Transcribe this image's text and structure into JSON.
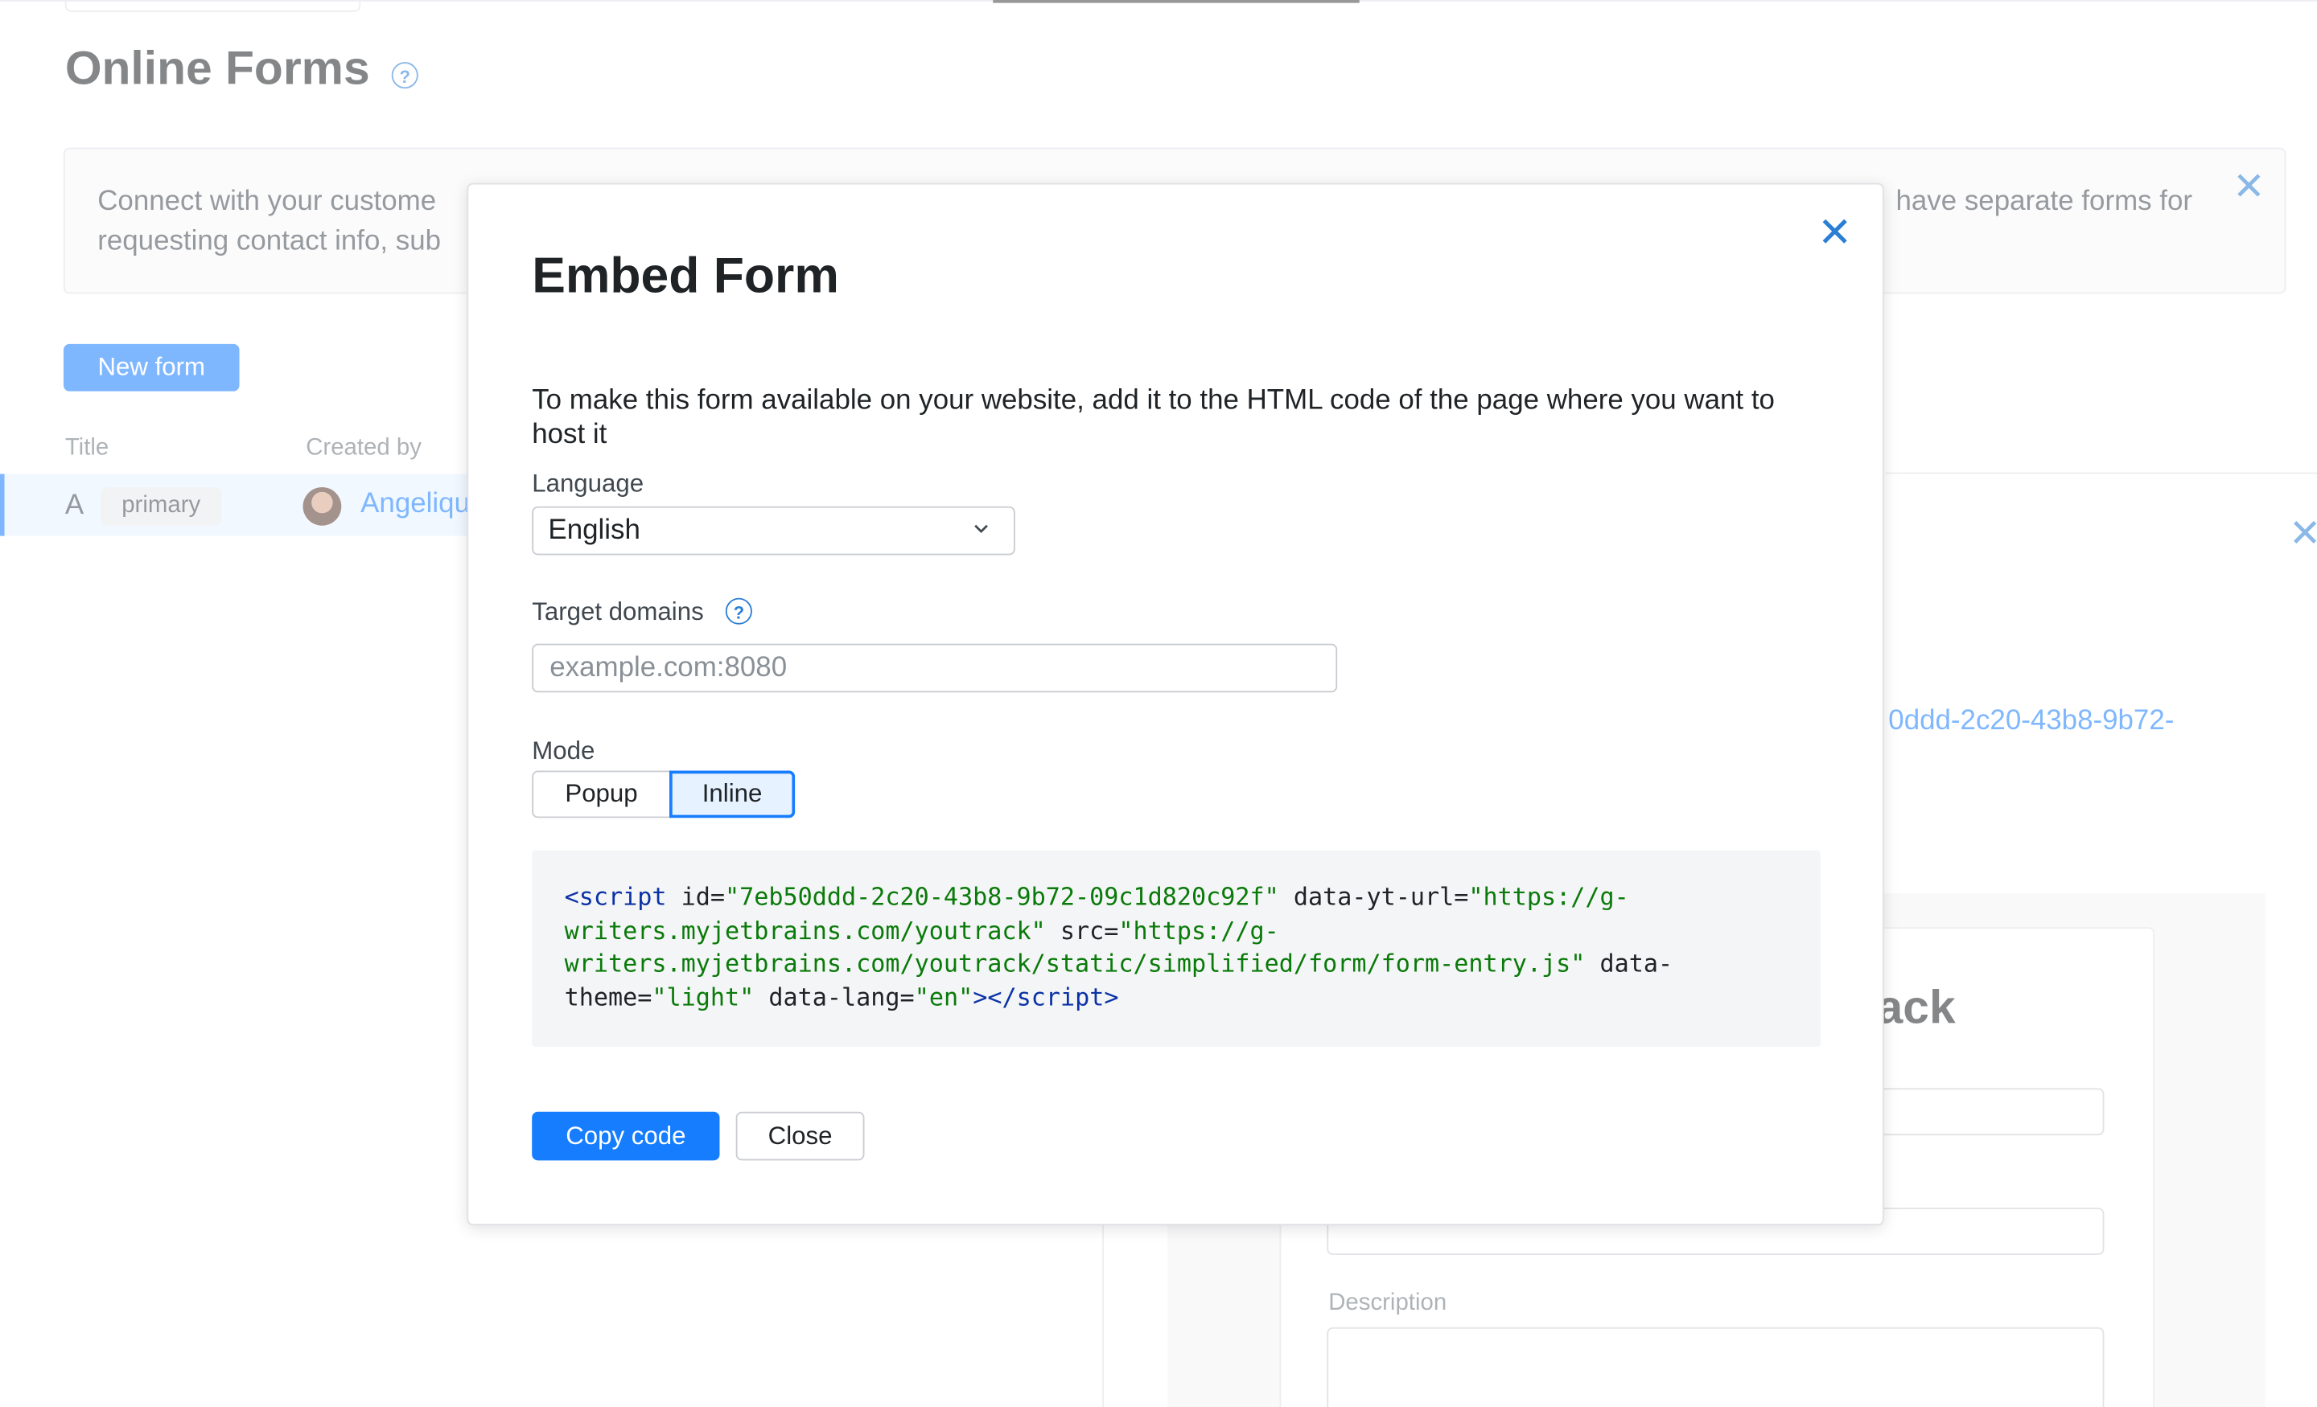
{
  "page": {
    "title": "Online Forms",
    "banner_line1_left": "Connect with your custome",
    "banner_line1_right": "have separate forms for",
    "banner_line2_left": "requesting contact info, sub",
    "new_form_label": "New form",
    "columns": [
      "Title",
      "Created by"
    ],
    "row": {
      "title": "A",
      "tag": "primary",
      "created_by": "Angeliqu"
    },
    "uuid_fragment": "0ddd-2c20-43b8-9b72-",
    "preview_heading_fragment": "ack",
    "preview_description_label": "Description"
  },
  "modal": {
    "title": "Embed Form",
    "description": "To make this form available on your website, add it to the HTML code of the page where you want to host it",
    "language_label": "Language",
    "language_value": "English",
    "target_domains_label": "Target domains",
    "target_domains_value": "",
    "target_domains_placeholder": "example.com:8080",
    "mode_label": "Mode",
    "mode_options": [
      "Popup",
      "Inline"
    ],
    "mode_selected": "Inline",
    "code": {
      "id": "7eb50ddd-2c20-43b8-9b72-09c1d820c92f",
      "yt_url": "https://g-writers.myjetbrains.com/youtrack",
      "src": "https://g-writers.myjetbrains.com/youtrack/static/simplified/form/form-entry.js",
      "theme": "light",
      "lang": "en"
    },
    "copy_code_label": "Copy code",
    "close_label": "Close"
  },
  "colors": {
    "accent": "#167dff",
    "code_tag": "#0b32a6",
    "code_string": "#0a7a0a"
  }
}
